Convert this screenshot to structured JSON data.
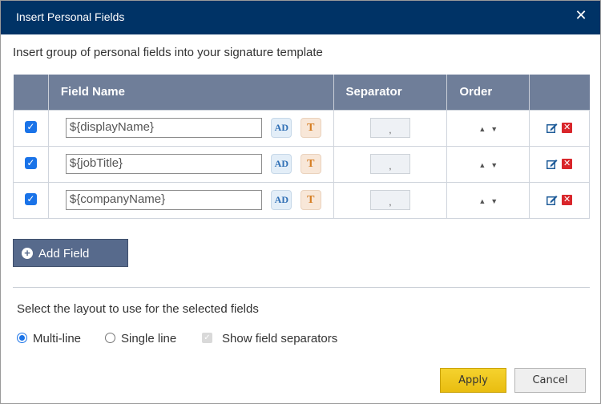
{
  "dialog": {
    "title": "Insert Personal Fields",
    "close_icon": "close-icon",
    "intro": "Insert group of personal fields into your signature template"
  },
  "table": {
    "headers": [
      "",
      "Field Name",
      "Separator",
      "Order",
      ""
    ],
    "rows": [
      {
        "checked": true,
        "field": "${displayName}",
        "ad_label": "AD",
        "t_label": "T",
        "separator": ","
      },
      {
        "checked": true,
        "field": "${jobTitle}",
        "ad_label": "AD",
        "t_label": "T",
        "separator": ","
      },
      {
        "checked": true,
        "field": "${companyName}",
        "ad_label": "AD",
        "t_label": "T",
        "separator": ","
      }
    ]
  },
  "add_field": {
    "label": "Add Field",
    "icon": "plus-circle-icon"
  },
  "layout": {
    "label": "Select the layout to use for the selected fields",
    "options": [
      {
        "label": "Multi-line",
        "selected": true
      },
      {
        "label": "Single line",
        "selected": false
      }
    ],
    "show_separators": {
      "label": "Show field separators",
      "checked": true,
      "disabled": true
    }
  },
  "buttons": {
    "apply": "Apply",
    "cancel": "Cancel"
  },
  "colors": {
    "titlebar": "#003366",
    "header": "#6f7e99",
    "add_button": "#576a8c",
    "apply": "#f0c91f",
    "delete": "#d9262b",
    "checkbox": "#1a73e8"
  }
}
